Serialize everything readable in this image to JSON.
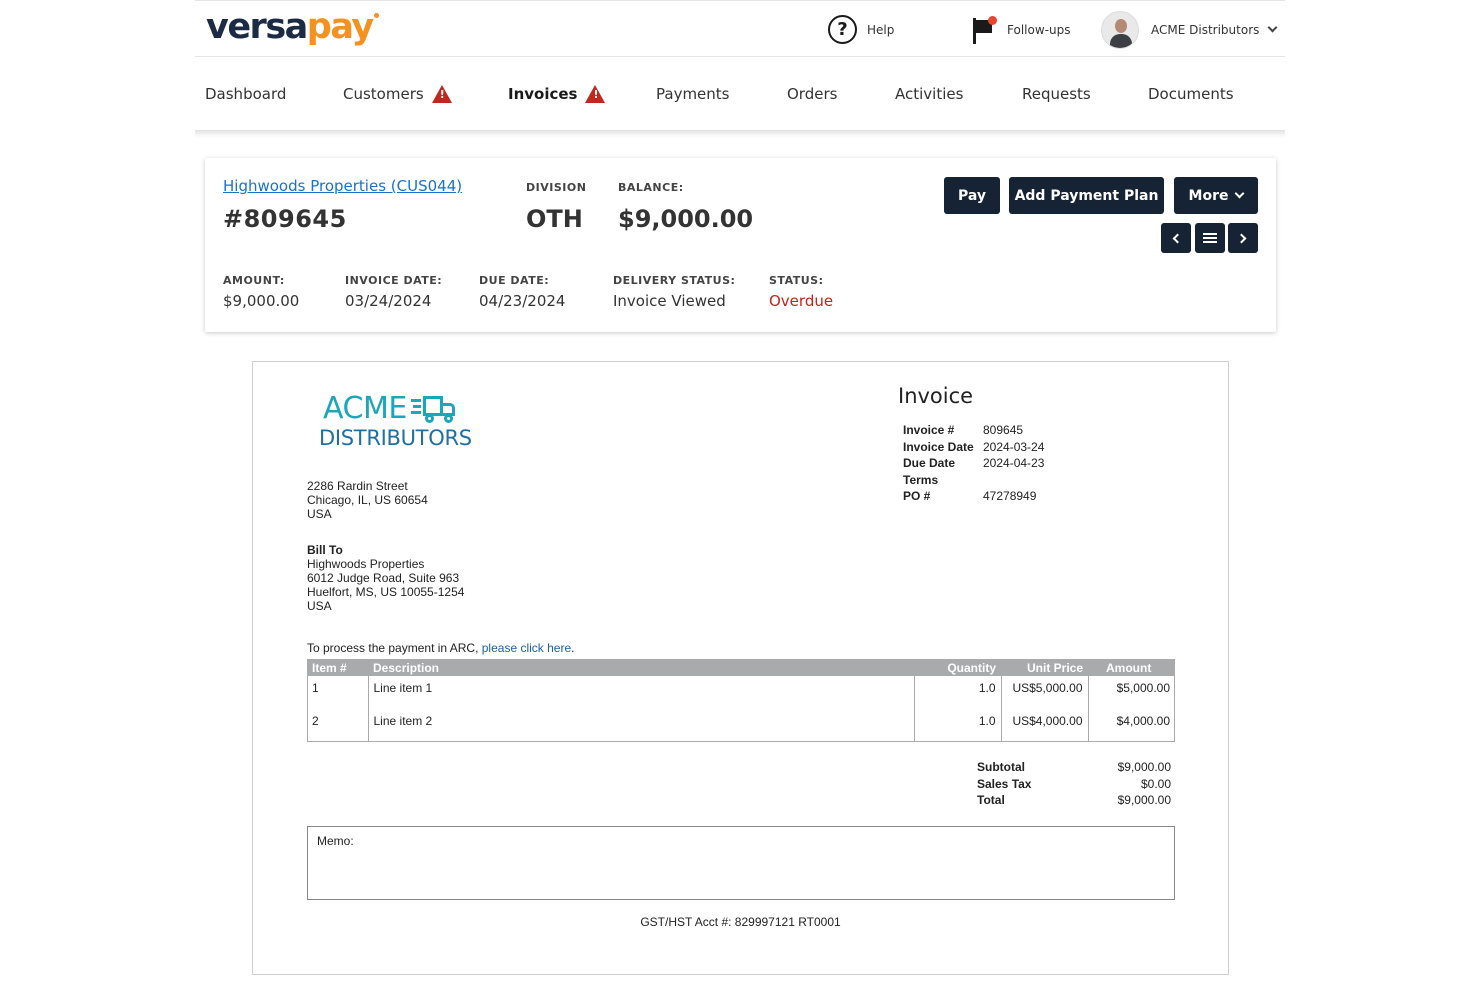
{
  "brand": {
    "part1": "versa",
    "part2": "pay"
  },
  "header": {
    "help_label": "Help",
    "followups_label": "Follow-ups",
    "account_label": "ACME Distributors"
  },
  "nav": {
    "items": [
      "Dashboard",
      "Customers",
      "Invoices",
      "Payments",
      "Orders",
      "Activities",
      "Requests",
      "Documents"
    ],
    "active": "Invoices",
    "warning_items": [
      "Customers",
      "Invoices"
    ]
  },
  "summary": {
    "customer_link": "Highwoods Properties (CUS044)",
    "invoice_number": "#809645",
    "division_label": "DIVISION",
    "division_value": "OTH",
    "balance_label": "BALANCE:",
    "balance_value": "$9,000.00",
    "amount_label": "AMOUNT:",
    "amount_value": "$9,000.00",
    "invoice_date_label": "INVOICE DATE:",
    "invoice_date_value": "03/24/2024",
    "due_date_label": "DUE DATE:",
    "due_date_value": "04/23/2024",
    "delivery_status_label": "DELIVERY STATUS:",
    "delivery_status_value": "Invoice Viewed",
    "status_label": "STATUS:",
    "status_value": "Overdue",
    "status_color": "#c4231b",
    "buttons": {
      "pay": "Pay",
      "add_plan": "Add Payment Plan",
      "more": "More"
    },
    "icons": [
      "chevron-left-icon",
      "list-icon",
      "chevron-right-icon"
    ]
  },
  "document": {
    "logo_top": "ACME",
    "logo_bottom": "DISTRIBUTORS",
    "logo_color": "#1ba6b9",
    "seller_address": [
      "2286 Rardin Street",
      "Chicago, IL, US 60654",
      "USA"
    ],
    "bill_to_label": "Bill To",
    "bill_to": [
      "Highwoods Properties",
      "6012 Judge Road, Suite 963",
      "Huelfort, MS, US 10055-1254",
      "USA"
    ],
    "title": "Invoice",
    "meta": [
      {
        "k": "Invoice #",
        "v": "809645"
      },
      {
        "k": "Invoice Date",
        "v": "2024-03-24"
      },
      {
        "k": "Due Date",
        "v": "2024-04-23"
      },
      {
        "k": "Terms",
        "v": ""
      },
      {
        "k": "PO #",
        "v": "47278949"
      }
    ],
    "pay_text": "To process the payment in ARC, ",
    "pay_link": "please click here",
    "pay_suffix": ".",
    "table": {
      "headers": [
        "Item #",
        "Description",
        "Quantity",
        "Unit Price",
        "Amount"
      ],
      "rows": [
        [
          "1",
          "Line item 1",
          "1.0",
          "US$5,000.00",
          "$5,000.00"
        ],
        [
          "2",
          "Line item 2",
          "1.0",
          "US$4,000.00",
          "$4,000.00"
        ]
      ]
    },
    "totals": [
      {
        "k": "Subtotal",
        "v": "$9,000.00"
      },
      {
        "k": "Sales Tax",
        "v": "$0.00"
      },
      {
        "k": "Total",
        "v": "$9,000.00"
      }
    ],
    "memo_label": "Memo:",
    "gst": "GST/HST Acct #: 829997121 RT0001"
  }
}
